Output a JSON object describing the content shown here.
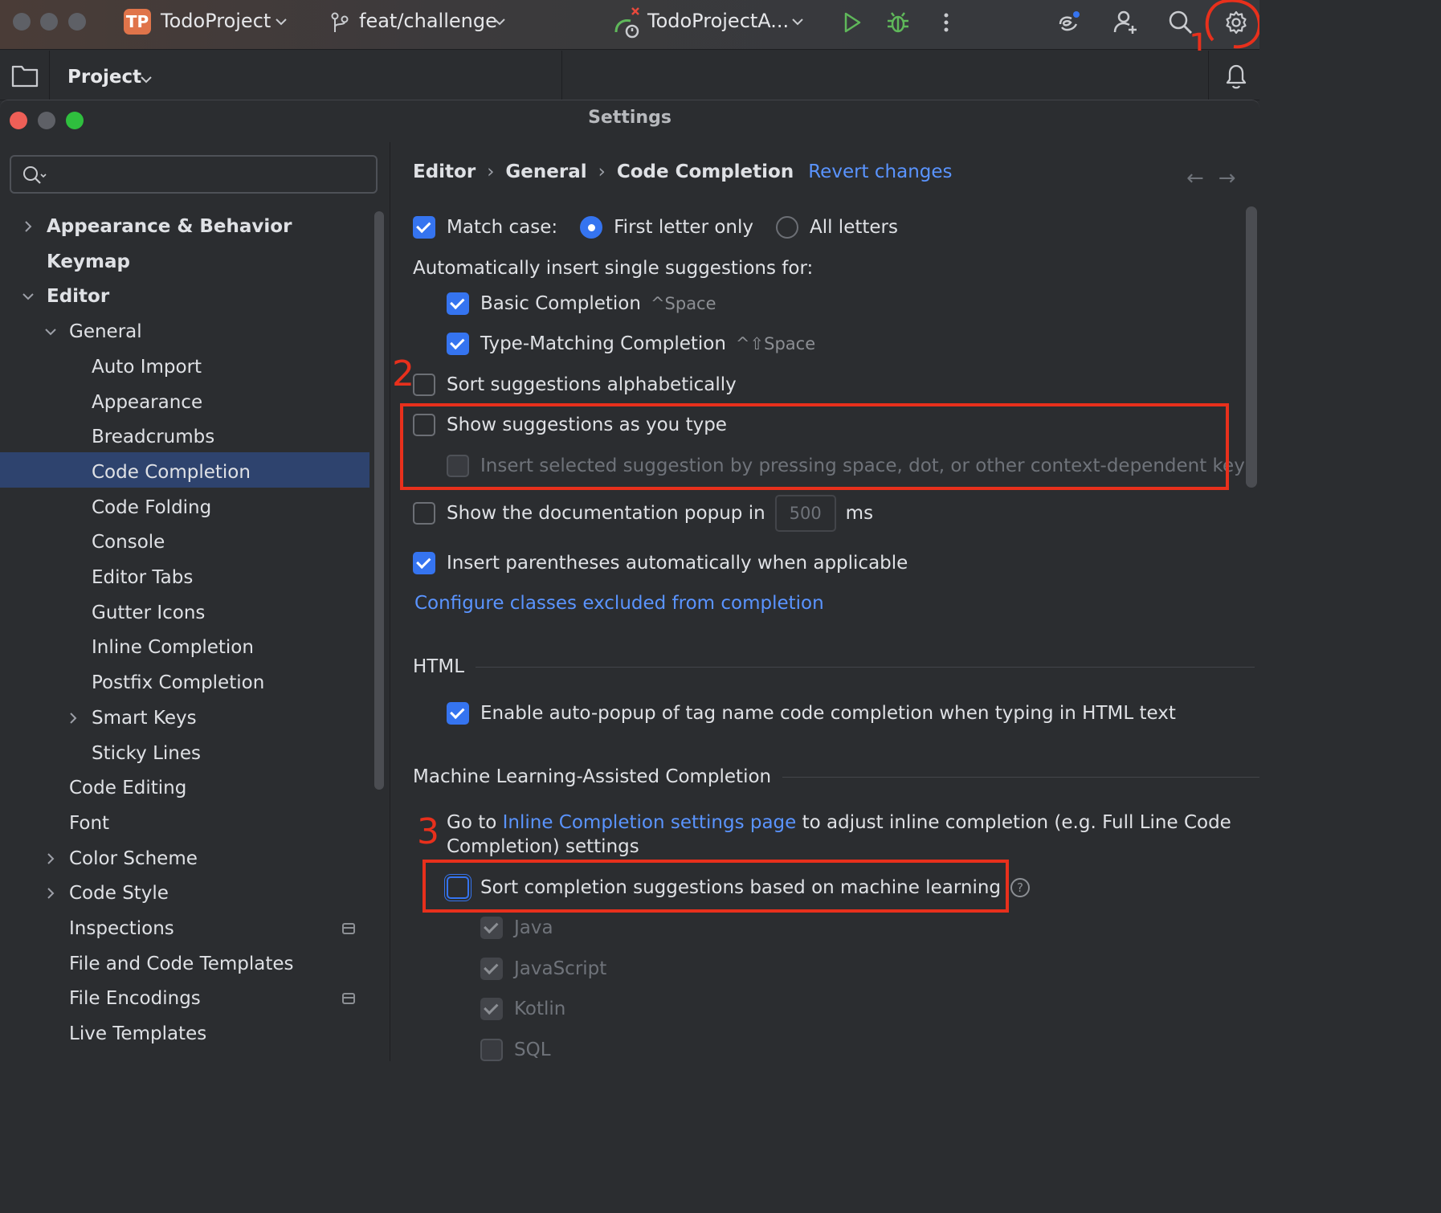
{
  "toolbar": {
    "project_badge": "TP",
    "project_name": "TodoProject",
    "branch": "feat/challenge",
    "run_config": "TodoProjectA...",
    "icons": [
      "vcs-branch-icon",
      "run-config-icon",
      "run-icon",
      "debug-icon",
      "more-icon",
      "ai-assistant-icon",
      "add-user-icon",
      "search-icon",
      "settings-gear-icon"
    ]
  },
  "project_panel": {
    "title": "Project"
  },
  "dialog": {
    "title": "Settings",
    "search_placeholder": ""
  },
  "sidebar": {
    "items": [
      {
        "label": "Appearance & Behavior",
        "bold": true,
        "indent": 0,
        "arrow": "right"
      },
      {
        "label": "Keymap",
        "bold": true,
        "indent": 0,
        "arrow": ""
      },
      {
        "label": "Editor",
        "bold": true,
        "indent": 0,
        "arrow": "down"
      },
      {
        "label": "General",
        "bold": false,
        "indent": 1,
        "arrow": "down"
      },
      {
        "label": "Auto Import",
        "bold": false,
        "indent": 2,
        "arrow": ""
      },
      {
        "label": "Appearance",
        "bold": false,
        "indent": 2,
        "arrow": ""
      },
      {
        "label": "Breadcrumbs",
        "bold": false,
        "indent": 2,
        "arrow": ""
      },
      {
        "label": "Code Completion",
        "bold": false,
        "indent": 2,
        "arrow": "",
        "selected": true
      },
      {
        "label": "Code Folding",
        "bold": false,
        "indent": 2,
        "arrow": ""
      },
      {
        "label": "Console",
        "bold": false,
        "indent": 2,
        "arrow": ""
      },
      {
        "label": "Editor Tabs",
        "bold": false,
        "indent": 2,
        "arrow": ""
      },
      {
        "label": "Gutter Icons",
        "bold": false,
        "indent": 2,
        "arrow": ""
      },
      {
        "label": "Inline Completion",
        "bold": false,
        "indent": 2,
        "arrow": ""
      },
      {
        "label": "Postfix Completion",
        "bold": false,
        "indent": 2,
        "arrow": ""
      },
      {
        "label": "Smart Keys",
        "bold": false,
        "indent": 2,
        "arrow": "right"
      },
      {
        "label": "Sticky Lines",
        "bold": false,
        "indent": 2,
        "arrow": ""
      },
      {
        "label": "Code Editing",
        "bold": false,
        "indent": 1,
        "arrow": ""
      },
      {
        "label": "Font",
        "bold": false,
        "indent": 1,
        "arrow": ""
      },
      {
        "label": "Color Scheme",
        "bold": false,
        "indent": 1,
        "arrow": "right"
      },
      {
        "label": "Code Style",
        "bold": false,
        "indent": 1,
        "arrow": "right"
      },
      {
        "label": "Inspections",
        "bold": false,
        "indent": 1,
        "arrow": "",
        "badge": true
      },
      {
        "label": "File and Code Templates",
        "bold": false,
        "indent": 1,
        "arrow": ""
      },
      {
        "label": "File Encodings",
        "bold": false,
        "indent": 1,
        "arrow": "",
        "badge": true
      },
      {
        "label": "Live Templates",
        "bold": false,
        "indent": 1,
        "arrow": ""
      }
    ]
  },
  "breadcrumb": {
    "items": [
      "Editor",
      "General",
      "Code Completion"
    ],
    "revert": "Revert changes"
  },
  "settings": {
    "match_case": {
      "label": "Match case:",
      "checked": true
    },
    "first_letter": {
      "label": "First letter only",
      "selected": true
    },
    "all_letters": {
      "label": "All letters",
      "selected": false
    },
    "auto_insert_heading": "Automatically insert single suggestions for:",
    "basic_completion": {
      "label": "Basic Completion",
      "shortcut": "^Space",
      "checked": true
    },
    "type_matching": {
      "label": "Type-Matching Completion",
      "shortcut": "^⇧Space",
      "checked": true
    },
    "sort_alpha": {
      "label": "Sort suggestions alphabetically",
      "checked": false
    },
    "show_as_you_type": {
      "label": "Show suggestions as you type",
      "checked": false
    },
    "insert_selected": {
      "label": "Insert selected suggestion by pressing space, dot, or other context-dependent keys",
      "checked": false,
      "disabled": true
    },
    "doc_popup": {
      "label": "Show the documentation popup in",
      "value": "500",
      "unit": "ms",
      "checked": false
    },
    "insert_parens": {
      "label": "Insert parentheses automatically when applicable",
      "checked": true
    },
    "configure_link": "Configure classes excluded from completion",
    "html_section": "HTML",
    "html_autopopup": {
      "label": "Enable auto-popup of tag name code completion when typing in HTML text",
      "checked": true
    },
    "ml_section": "Machine Learning-Assisted Completion",
    "ml_goto_prefix": "Go to",
    "ml_goto_link": "Inline Completion settings page",
    "ml_goto_suffix": "to adjust inline completion (e.g. Full Line Code",
    "ml_goto_line2": "Completion) settings",
    "ml_sort": {
      "label": "Sort completion suggestions based on machine learning",
      "checked": false
    },
    "ml_java": {
      "label": "Java",
      "checked": true
    },
    "ml_javascript": {
      "label": "JavaScript",
      "checked": true
    },
    "ml_kotlin": {
      "label": "Kotlin",
      "checked": true
    },
    "ml_sql": {
      "label": "SQL",
      "checked": false
    }
  },
  "annotations": {
    "n1": "1",
    "n2": "2",
    "n3": "3",
    "color": "#e8301c"
  },
  "colors": {
    "accent": "#3574f0",
    "link": "#5a94ff",
    "selection": "#2e436e"
  }
}
